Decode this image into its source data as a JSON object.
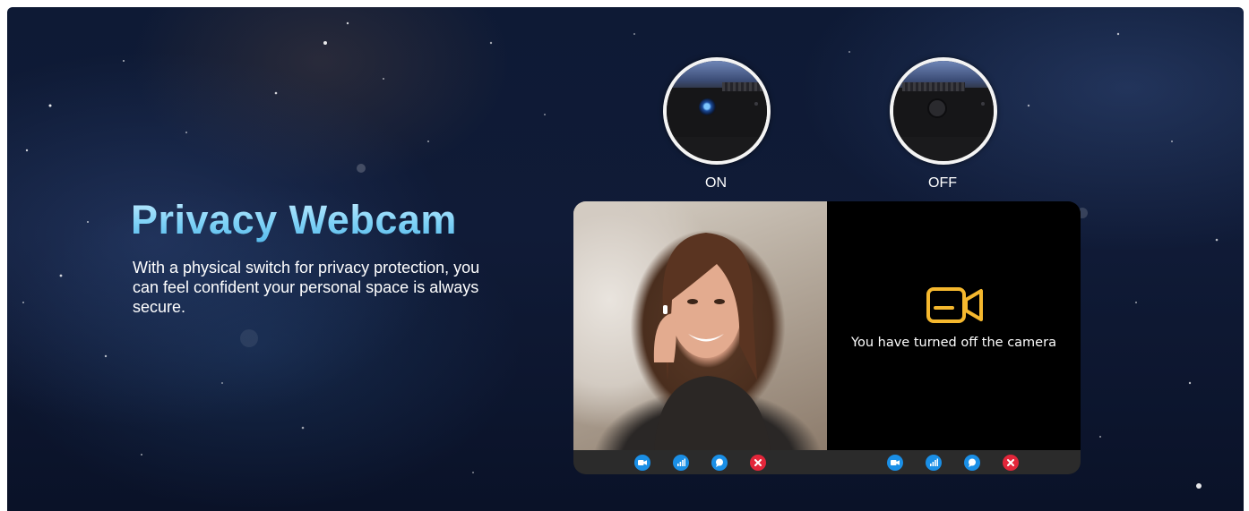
{
  "hero": {
    "title": "Privacy Webcam",
    "description": "With a physical switch for privacy protection, you can feel confident your personal space is always secure."
  },
  "switch_states": [
    {
      "label": "ON",
      "icon": "webcam-lens-open-icon"
    },
    {
      "label": "OFF",
      "icon": "webcam-lens-covered-icon"
    }
  ],
  "call_screen": {
    "off_message": "You have turned off the camera",
    "off_icon": "video-camera-icon",
    "controls": [
      {
        "icon": "video-camera-icon",
        "color": "#1a8fe6"
      },
      {
        "icon": "signal-icon",
        "color": "#1a8fe6"
      },
      {
        "icon": "chat-bubble-icon",
        "color": "#1a8fe6"
      },
      {
        "icon": "close-icon",
        "color": "#e3263a"
      }
    ]
  },
  "colors": {
    "title_gradient_top": "#c4ecff",
    "title_gradient_bottom": "#56b9ea",
    "accent_icon": "#f5b82e",
    "background": "#0e1a35"
  }
}
